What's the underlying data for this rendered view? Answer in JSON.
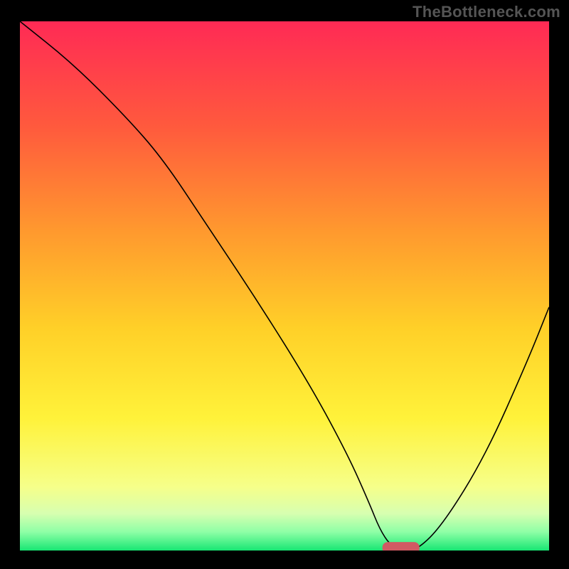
{
  "watermark": "TheBottleneck.com",
  "chart_data": {
    "type": "line",
    "title": "",
    "xlabel": "",
    "ylabel": "",
    "xlim": [
      0,
      100
    ],
    "ylim": [
      0,
      100
    ],
    "grid": false,
    "legend": false,
    "background_gradient_stops": [
      {
        "offset": 0.0,
        "color": "#ff2a55"
      },
      {
        "offset": 0.2,
        "color": "#ff5a3d"
      },
      {
        "offset": 0.4,
        "color": "#ff9a2e"
      },
      {
        "offset": 0.58,
        "color": "#ffd028"
      },
      {
        "offset": 0.75,
        "color": "#fff23a"
      },
      {
        "offset": 0.88,
        "color": "#f6ff8a"
      },
      {
        "offset": 0.93,
        "color": "#d7ffb0"
      },
      {
        "offset": 0.965,
        "color": "#8effa6"
      },
      {
        "offset": 1.0,
        "color": "#18e673"
      }
    ],
    "series": [
      {
        "name": "bottleneck-curve",
        "color": "#000000",
        "x": [
          0,
          10,
          20,
          27,
          35,
          45,
          55,
          62,
          66,
          68,
          70,
          72,
          75,
          80,
          88,
          96,
          100
        ],
        "y": [
          100,
          92,
          82,
          74,
          62,
          47,
          31,
          18,
          9,
          4,
          1,
          0,
          0,
          5,
          18,
          36,
          46
        ]
      }
    ],
    "marker": {
      "name": "optimal-marker",
      "x": 72,
      "y": 0.5,
      "width": 7,
      "height": 2.2,
      "color": "#d15a63"
    }
  }
}
